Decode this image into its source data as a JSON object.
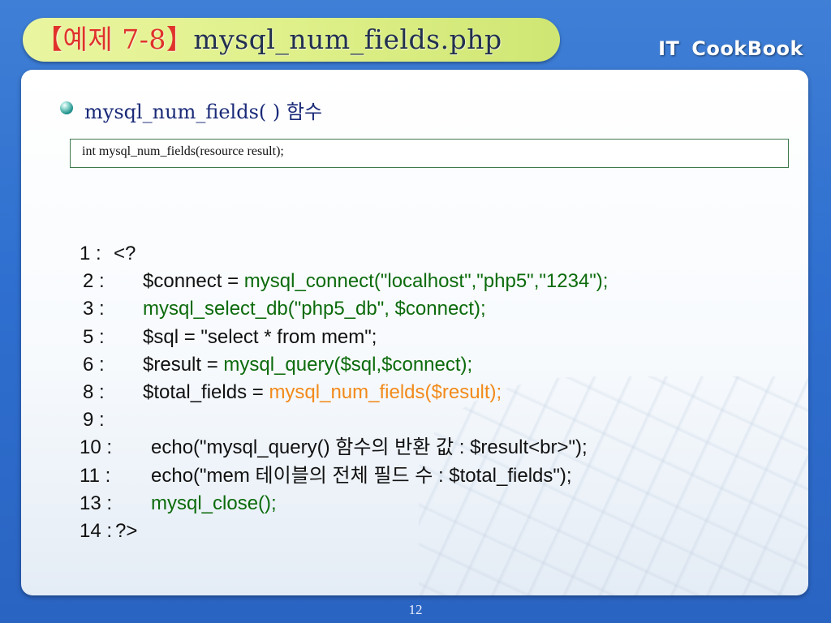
{
  "slide": {
    "title_prefix": "【예제 7-8】",
    "title_main": "mysql_num_fields.php",
    "brand": "IT CookBook",
    "heading": "mysql_num_fields( ) 함수",
    "signature": "int mysql_num_fields(resource result);",
    "page_number": "12"
  },
  "code": {
    "lines": [
      {
        "num": "1 :",
        "parts": [
          {
            "text": "<?",
            "style": "normal"
          }
        ]
      },
      {
        "num": "2 :",
        "parts": [
          {
            "text": "$connect = ",
            "style": "normal"
          },
          {
            "text": "mysql_connect(\"localhost\",\"php5\",\"1234\");",
            "style": "green"
          }
        ]
      },
      {
        "num": "3 :",
        "parts": [
          {
            "text": "mysql_select_db(\"php5_db\", $connect);",
            "style": "green"
          }
        ]
      },
      {
        "num": "5 :",
        "parts": [
          {
            "text": "$sql = \"select * from mem\";",
            "style": "normal"
          }
        ]
      },
      {
        "num": "6 :",
        "parts": [
          {
            "text": "$result = ",
            "style": "normal"
          },
          {
            "text": "mysql_query($sql,$connect);",
            "style": "green"
          }
        ]
      },
      {
        "num": "8 :",
        "parts": [
          {
            "text": "$total_fields = ",
            "style": "normal"
          },
          {
            "text": "mysql_num_fields($result);",
            "style": "orange"
          }
        ]
      },
      {
        "num": "9 :",
        "parts": []
      },
      {
        "num": "10 :",
        "parts": [
          {
            "text": "echo(\"mysql_query() 함수의 반환 값 : $result<br>\");",
            "style": "normal"
          }
        ]
      },
      {
        "num": "11 :",
        "parts": [
          {
            "text": "echo(\"mem 테이블의 전체 필드 수 : $total_fields\");",
            "style": "normal"
          }
        ]
      },
      {
        "num": "13 :",
        "parts": [
          {
            "text": "mysql_close();",
            "style": "green"
          }
        ]
      },
      {
        "num": "14 :",
        "parts": [
          {
            "text": "?>",
            "style": "normal"
          }
        ]
      }
    ]
  },
  "colors": {
    "code_green": "#0c6b0c",
    "code_orange": "#f28a1a",
    "title_red": "#e0322b",
    "heading_blue": "#1a2a78"
  }
}
